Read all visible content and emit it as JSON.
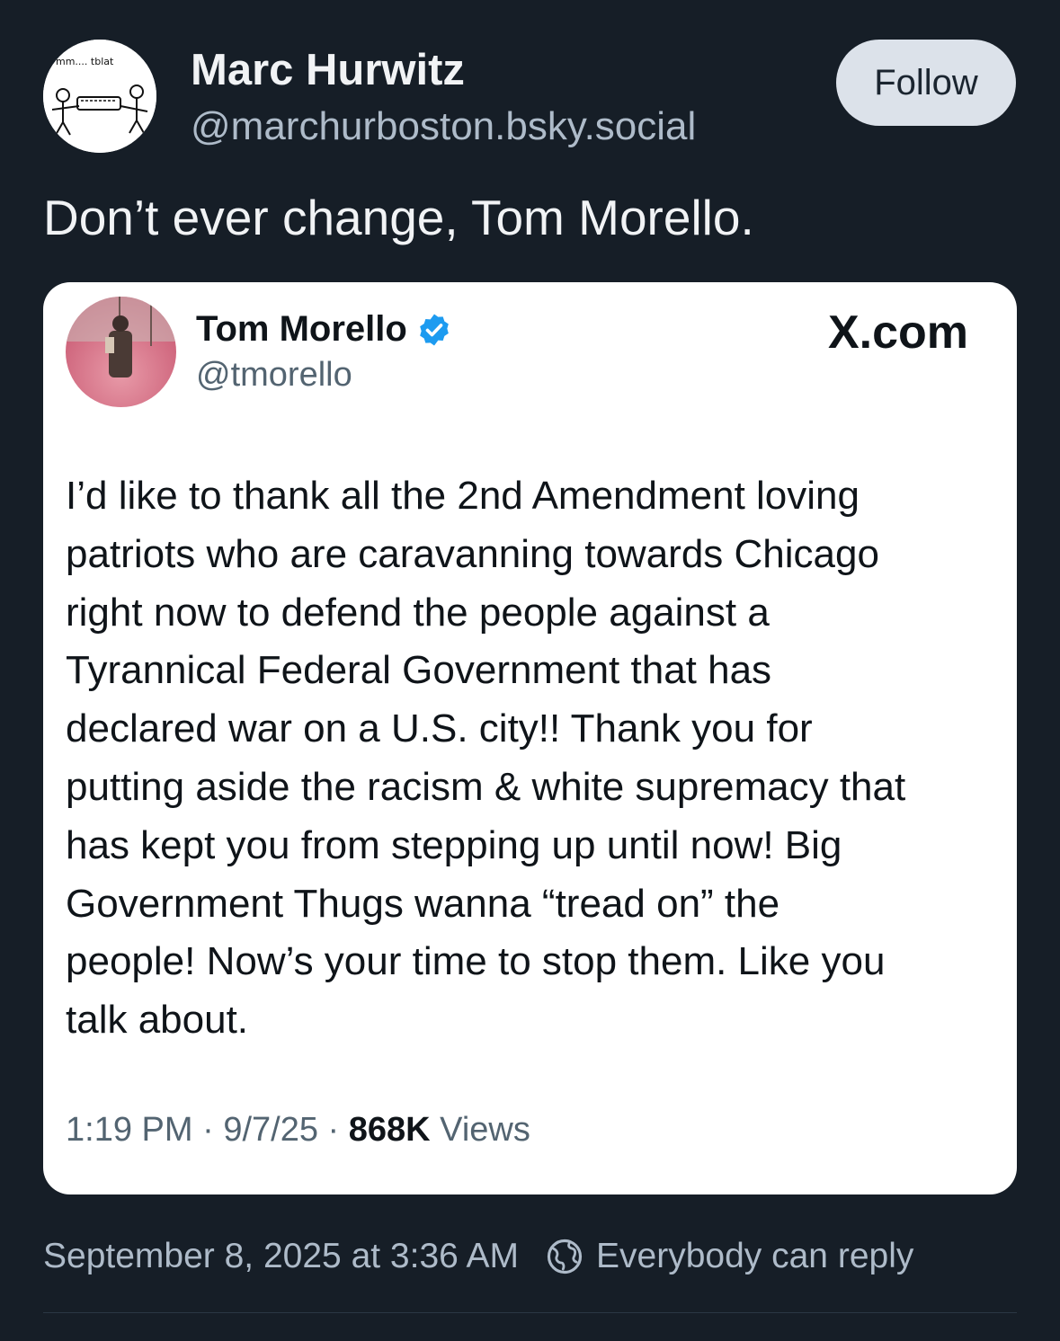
{
  "author": {
    "display_name": "Marc Hurwitz",
    "handle": "@marchurboston.bsky.social",
    "avatar_icon": "drawn-stick-figures-avatar",
    "avatar_text": "mm.... tblat"
  },
  "follow_label": "Follow",
  "post_text": "Don’t ever change, Tom Morello.",
  "embed": {
    "display_name": "Tom Morello",
    "verified_icon": "verified-badge-icon",
    "handle": "@tmorello",
    "source": "X.com",
    "text_lines": [
      "I’d like to thank all the 2nd Amendment loving",
      "patriots who are caravanning towards Chicago",
      "right now to defend the people against a",
      "Tyrannical Federal Government that has",
      "declared war on a U.S. city!! Thank you for",
      "putting aside the racism & white supremacy that",
      "has kept you from stepping up until now! Big",
      "Government Thugs wanna “tread on” the",
      "people! Now’s your time to stop them. Like you",
      "talk about."
    ],
    "time": "1:19 PM",
    "date": "9/7/25",
    "sep": "·",
    "views_count": "868K",
    "views_label": "Views"
  },
  "footer": {
    "timestamp": "September 8, 2025 at 3:36 AM",
    "reply_icon": "globe-icon",
    "reply_setting": "Everybody can reply"
  },
  "colors": {
    "background": "#161e27",
    "muted": "#aebbc9",
    "verified": "#1d9bf0",
    "follow_bg": "#dce2ea"
  }
}
